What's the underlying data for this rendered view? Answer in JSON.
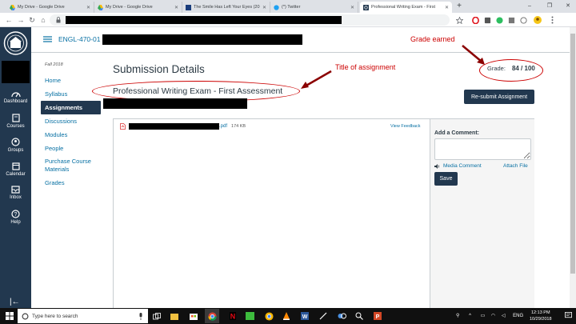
{
  "browser": {
    "tabs": [
      {
        "label": "My Drive - Google Drive",
        "icon": "google-drive-icon",
        "active": false
      },
      {
        "label": "My Drive - Google Drive",
        "icon": "google-drive-icon",
        "active": false
      },
      {
        "label": "The Smile Has Left Your Eyes (20",
        "icon": "site-icon",
        "active": false
      },
      {
        "label": "(*) Twitter",
        "icon": "twitter-icon",
        "active": false
      },
      {
        "label": "Professional Writing Exam - First",
        "icon": "canvas-icon",
        "active": true
      }
    ],
    "new_tab": "+",
    "window_controls": [
      "–",
      "❐",
      "✕"
    ]
  },
  "global_nav": {
    "items": [
      {
        "label": "Dashboard",
        "icon": "dashboard-icon"
      },
      {
        "label": "Courses",
        "icon": "courses-icon"
      },
      {
        "label": "Groups",
        "icon": "groups-icon"
      },
      {
        "label": "Calendar",
        "icon": "calendar-icon"
      },
      {
        "label": "Inbox",
        "icon": "inbox-icon"
      },
      {
        "label": "Help",
        "icon": "help-icon"
      }
    ],
    "collapse": "|←"
  },
  "course": {
    "code": "ENGL-470-01",
    "term": "Fall 2018",
    "nav": [
      {
        "label": "Home",
        "active": false
      },
      {
        "label": "Syllabus",
        "active": false
      },
      {
        "label": "Assignments",
        "active": true
      },
      {
        "label": "Discussions",
        "active": false
      },
      {
        "label": "Modules",
        "active": false
      },
      {
        "label": "People",
        "active": false
      },
      {
        "label": "Purchase Course Materials",
        "active": false
      },
      {
        "label": "Grades",
        "active": false
      }
    ]
  },
  "submission": {
    "heading": "Submission Details",
    "grade_label": "Grade:",
    "grade_value": "84 / 100",
    "assignment_title": "Professional Writing Exam - First Assessment",
    "resubmit_label": "Re-submit Assignment",
    "file": {
      "extension": ".pdf",
      "size": "174 KB"
    },
    "view_feedback": "View Feedback",
    "comment_label": "Add a Comment:",
    "media_comment": "Media Comment",
    "attach_file": "Attach File",
    "save_label": "Save"
  },
  "annotations": {
    "grade_earned": "Grade earned",
    "title_of_assignment": "Title of assignment",
    "color": "#cc0000"
  },
  "taskbar": {
    "search_placeholder": "Type here to search",
    "language": "ENG",
    "time": "12:13 PM",
    "date": "10/29/2018"
  },
  "colors": {
    "nav_bg": "#22384f",
    "link": "#0770a3",
    "annotation": "#cc0000"
  }
}
